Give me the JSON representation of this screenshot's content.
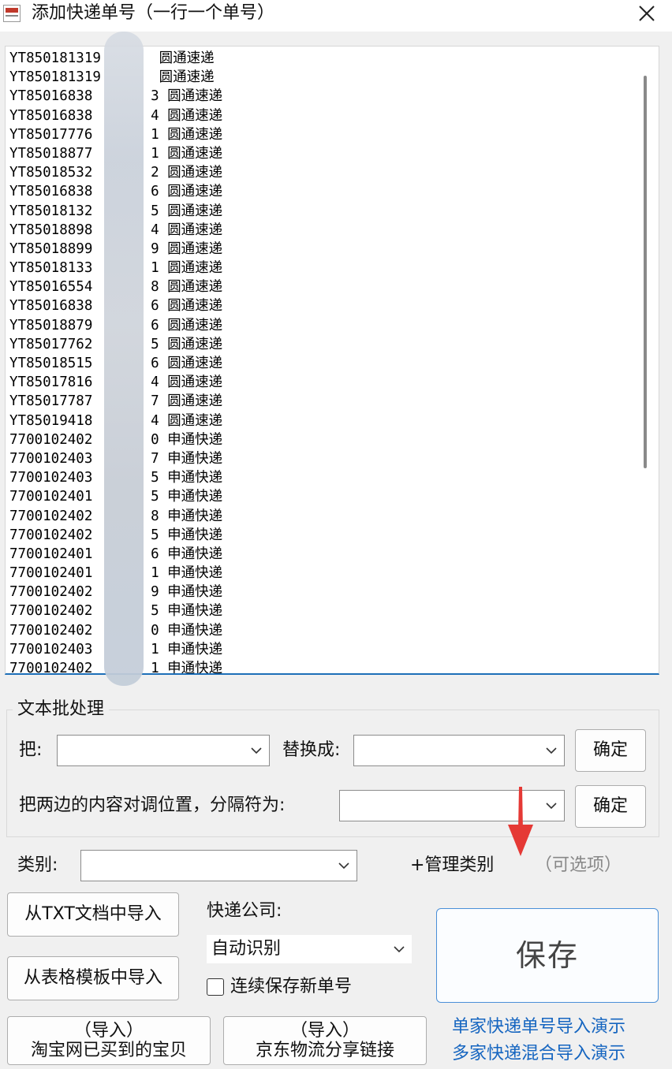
{
  "window": {
    "title": "添加快递单号（一行一个单号）",
    "close_icon": "close-icon"
  },
  "textarea": {
    "lines": [
      "YT850181319       圆通速递",
      "YT850181319       圆通速递",
      "YT85016838       3 圆通速递",
      "YT85016838       4 圆通速递",
      "YT85017776       1 圆通速递",
      "YT85018877       1 圆通速递",
      "YT85018532       2 圆通速递",
      "YT85016838       6 圆通速递",
      "YT85018132       5 圆通速递",
      "YT85018898       4 圆通速递",
      "YT85018899       9 圆通速递",
      "YT85018133       1 圆通速递",
      "YT85016554       8 圆通速递",
      "YT85016838       6 圆通速递",
      "YT85018879       6 圆通速递",
      "YT85017762       5 圆通速递",
      "YT85018515       6 圆通速递",
      "YT85017816       4 圆通速递",
      "YT85017787       7 圆通速递",
      "YT85019418       4 圆通速递",
      "7700102402       0 申通快递",
      "7700102403       7 申通快递",
      "7700102403       5 申通快递",
      "7700102401       5 申通快递",
      "7700102402       8 申通快递",
      "7700102402       5 申通快递",
      "7700102401       6 申通快递",
      "7700102401       1 申通快递",
      "7700102402       9 申通快递",
      "7700102402       5 申通快递",
      "7700102402       0 申通快递",
      "7700102403       1 申通快递",
      "7700102402       1 申通快递"
    ]
  },
  "batch": {
    "group_title": "文本批处理",
    "replace_from_label": "把:",
    "replace_from_value": "",
    "replace_to_label": "替换成:",
    "replace_to_value": "",
    "confirm_label_1": "确定",
    "swap_label": "把两边的内容对调位置，分隔符为:",
    "separator_value": "",
    "confirm_label_2": "确定"
  },
  "category": {
    "label": "类别:",
    "value": "",
    "manage_label": "+管理类别",
    "optional_hint": "（可选项）"
  },
  "import": {
    "txt_button": "从TXT文档中导入",
    "template_button": "从表格模板中导入",
    "taobao_button_line1": "（导入）",
    "taobao_button_line2": "淘宝网已买到的宝贝",
    "jd_button_line1": "（导入）",
    "jd_button_line2": "京东物流分享链接"
  },
  "courier": {
    "label": "快递公司:",
    "selected": "自动识别"
  },
  "save_new": {
    "label": "连续保存新单号",
    "checked": false
  },
  "save_button": "保存",
  "demo_links": {
    "single": "单家快递单号导入演示",
    "multi": "多家快递混合导入演示"
  }
}
